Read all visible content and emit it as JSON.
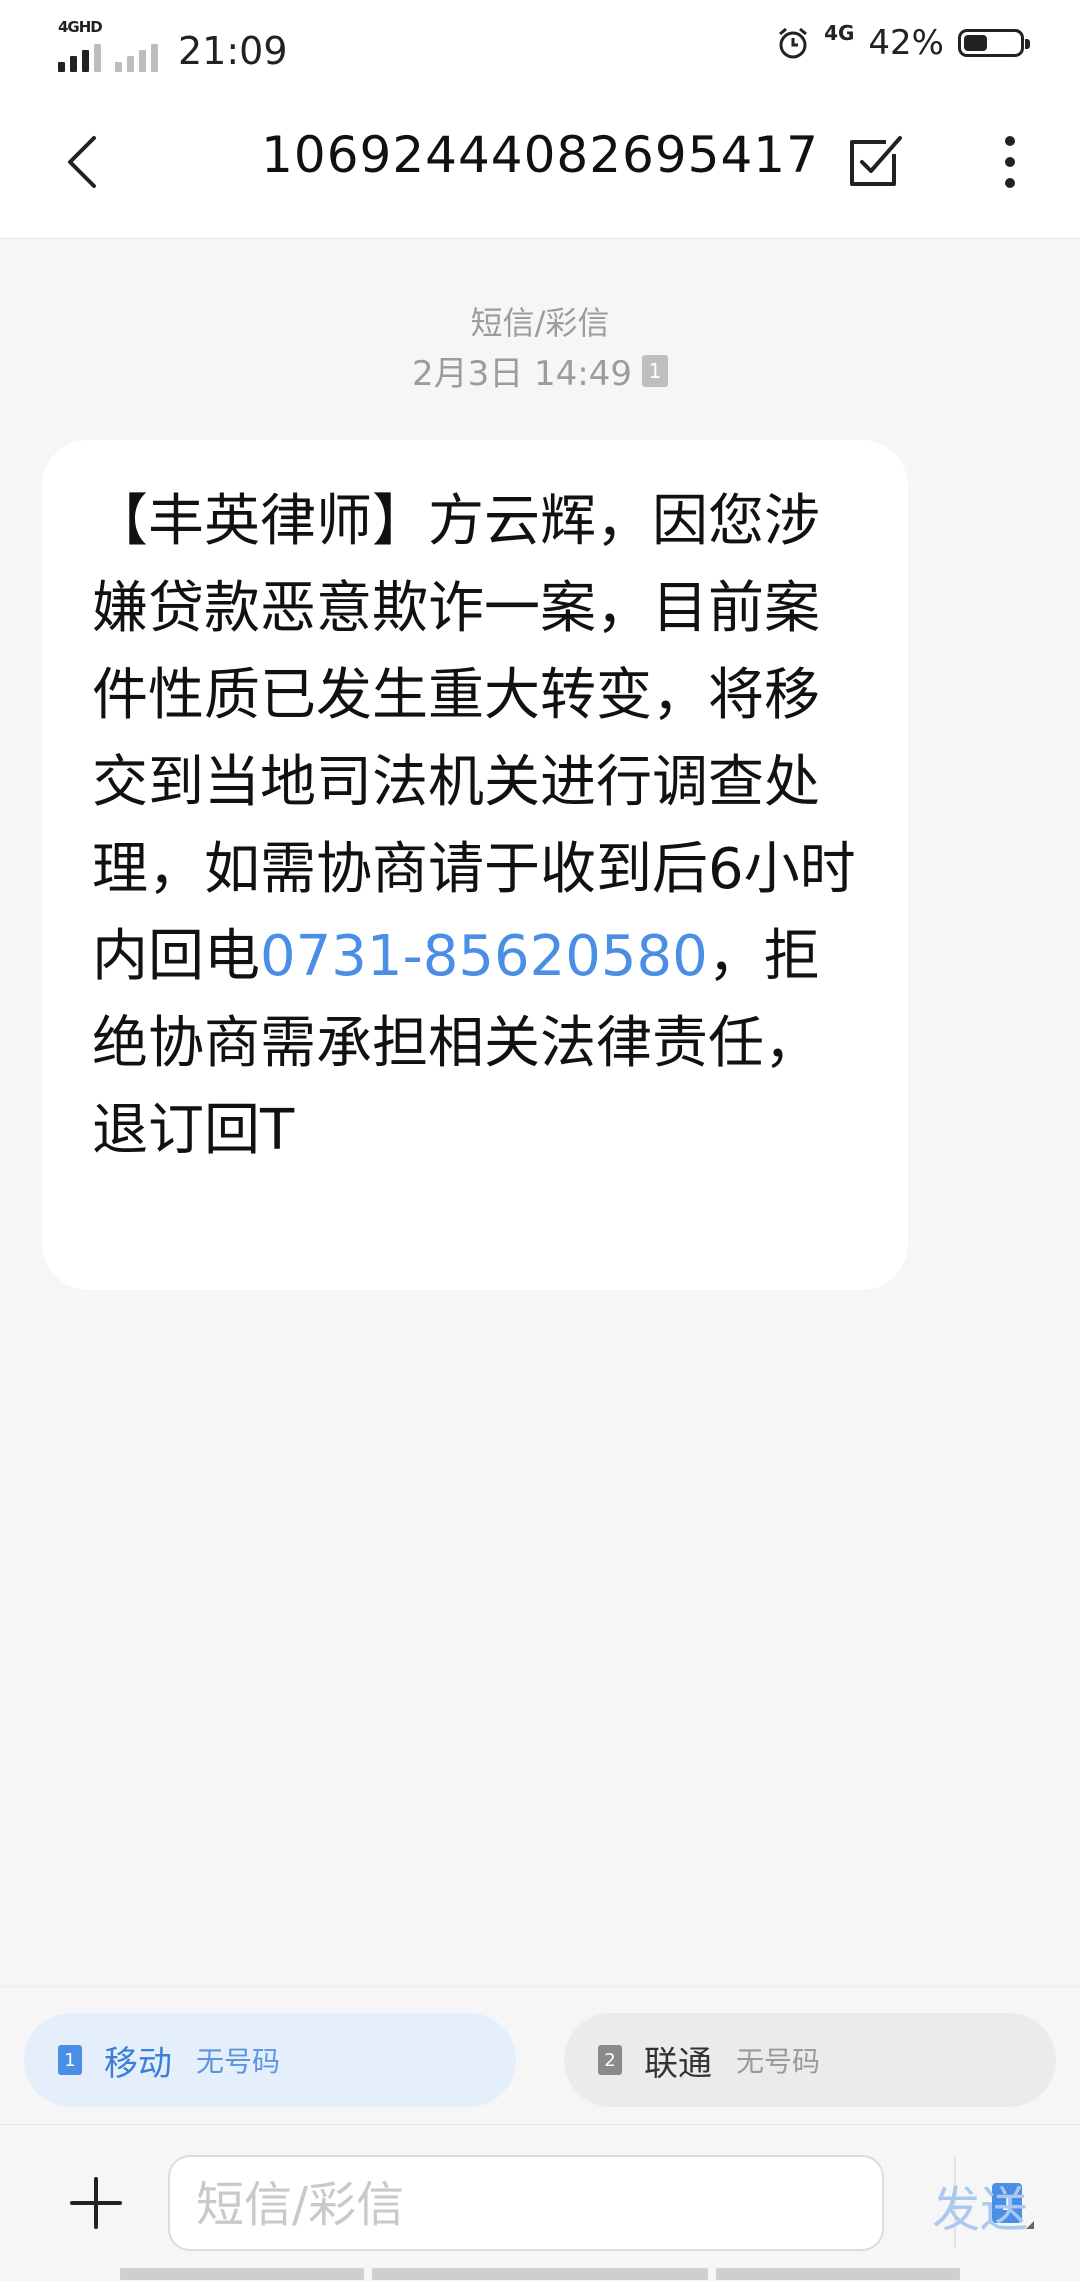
{
  "status_bar": {
    "network_type": "4GHD",
    "time": "21:09",
    "network_right": "4G",
    "battery_percent": "42%",
    "battery_level": 0.42
  },
  "header": {
    "title": "10692444082695417"
  },
  "conversation": {
    "message_type": "短信/彩信",
    "timestamp": "2月3日 14:49",
    "sim_badge": "1",
    "message": {
      "text_before": "【丰英律师】方云辉，因您涉嫌贷款恶意欺诈一案，目前案件性质已发生重大转变，将移交到当地司法机关进行调查处理，如需协商请于收到后6小时内回电",
      "phone_number": "0731-85620580",
      "text_after": "，拒绝协商需承担相关法律责任，退订回T"
    }
  },
  "sim_options": [
    {
      "badge": "1",
      "name": "移动",
      "subtitle": "无号码"
    },
    {
      "badge": "2",
      "name": "联通",
      "subtitle": "无号码"
    }
  ],
  "composer": {
    "placeholder": "短信/彩信",
    "sim_badge": "1",
    "send_label": "发送"
  },
  "colors": {
    "accent": "#4a8ee6",
    "background": "#f6f6f6",
    "bubble": "#ffffff"
  }
}
